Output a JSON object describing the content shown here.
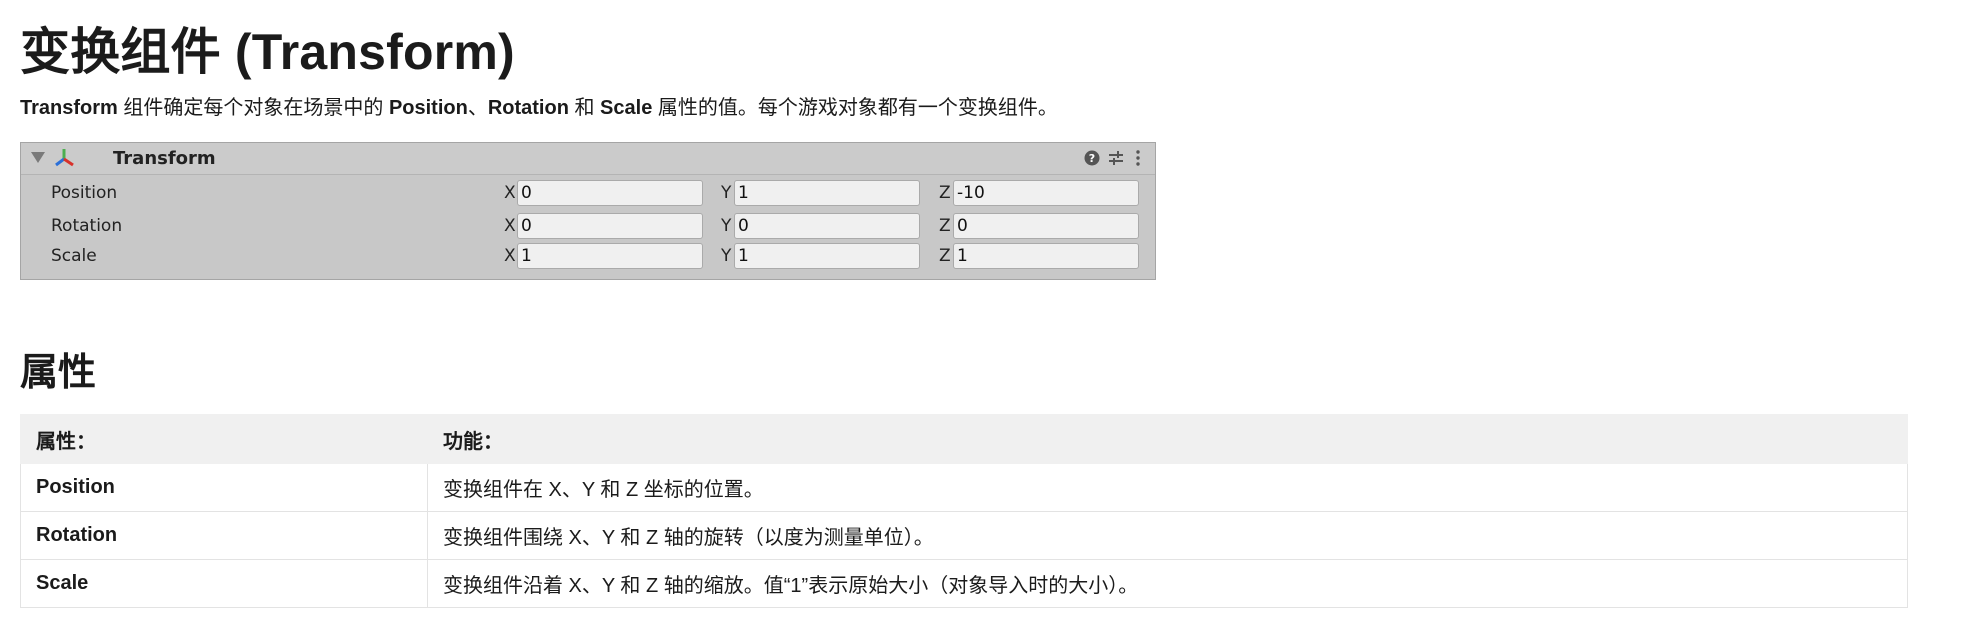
{
  "page": {
    "title": "变换组件 (Transform)",
    "intro": {
      "part1": "Transform",
      "part2": " 组件确定每个对象在场景中的 ",
      "part3": "Position",
      "part4": "、",
      "part5": "Rotation",
      "part6": " 和 ",
      "part7": "Scale",
      "part8": " 属性的值。每个游戏对象都有一个变换组件。"
    }
  },
  "inspector": {
    "title": "Transform",
    "header_icons": [
      "help-icon",
      "preset-icon",
      "more-options-icon"
    ],
    "rows": [
      {
        "label": "Position",
        "x_axis": "X",
        "x": "0",
        "y_axis": "Y",
        "y": "1",
        "z_axis": "Z",
        "z": "-10"
      },
      {
        "label": "Rotation",
        "x_axis": "X",
        "x": "0",
        "y_axis": "Y",
        "y": "0",
        "z_axis": "Z",
        "z": "0"
      },
      {
        "label": "Scale",
        "x_axis": "X",
        "x": "1",
        "y_axis": "Y",
        "y": "1",
        "z_axis": "Z",
        "z": "1"
      }
    ]
  },
  "properties_section": {
    "heading": "属性",
    "columns": [
      "属性：",
      "功能："
    ],
    "rows": [
      {
        "name": "Position",
        "desc": "变换组件在 X、Y 和 Z 坐标的位置。"
      },
      {
        "name": "Rotation",
        "desc": "变换组件围绕 X、Y 和 Z 轴的旋转（以度为测量单位）。"
      },
      {
        "name": "Scale",
        "desc": "变换组件沿着 X、Y 和 Z 轴的缩放。值“1”表示原始大小（对象导入时的大小）。"
      }
    ]
  }
}
